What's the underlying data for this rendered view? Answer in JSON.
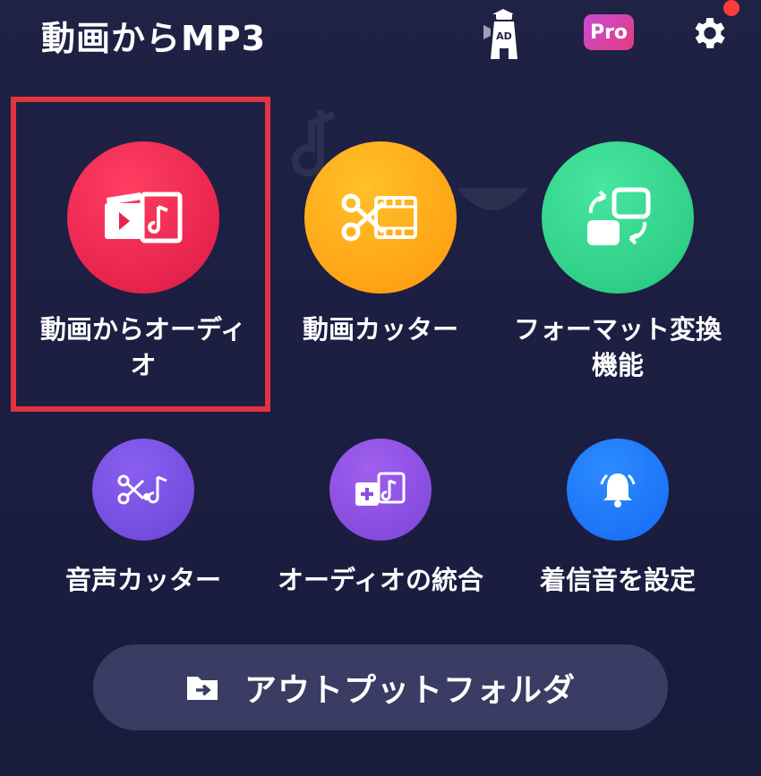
{
  "header": {
    "title": "動画からMP3",
    "ad_badge": "AD",
    "pro_badge": "Pro"
  },
  "tools": [
    {
      "label_line1": "動画からオーディ",
      "label_line2": "オ",
      "icon": "video-to-audio-icon",
      "color": "#e8244e"
    },
    {
      "label_line1": "動画カッター",
      "label_line2": "",
      "icon": "video-cutter-icon",
      "color": "#ffa415"
    },
    {
      "label_line1": "フォーマット変換",
      "label_line2": "機能",
      "icon": "format-convert-icon",
      "color": "#2fd088"
    },
    {
      "label_line1": "音声カッター",
      "icon": "audio-cutter-icon",
      "color": "#6b46d8"
    },
    {
      "label_line1": "オーディオの統合",
      "icon": "audio-merge-icon",
      "color": "#7d44d6"
    },
    {
      "label_line1": "着信音を設定",
      "icon": "ringtone-bell-icon",
      "color": "#1769f5"
    }
  ],
  "output_button": {
    "label": "アウトプットフォルダ",
    "icon": "folder-arrow-icon"
  },
  "colors": {
    "background": "#1c1e42",
    "highlight_border": "#e3333f",
    "notification_dot": "#ff3a3a"
  }
}
